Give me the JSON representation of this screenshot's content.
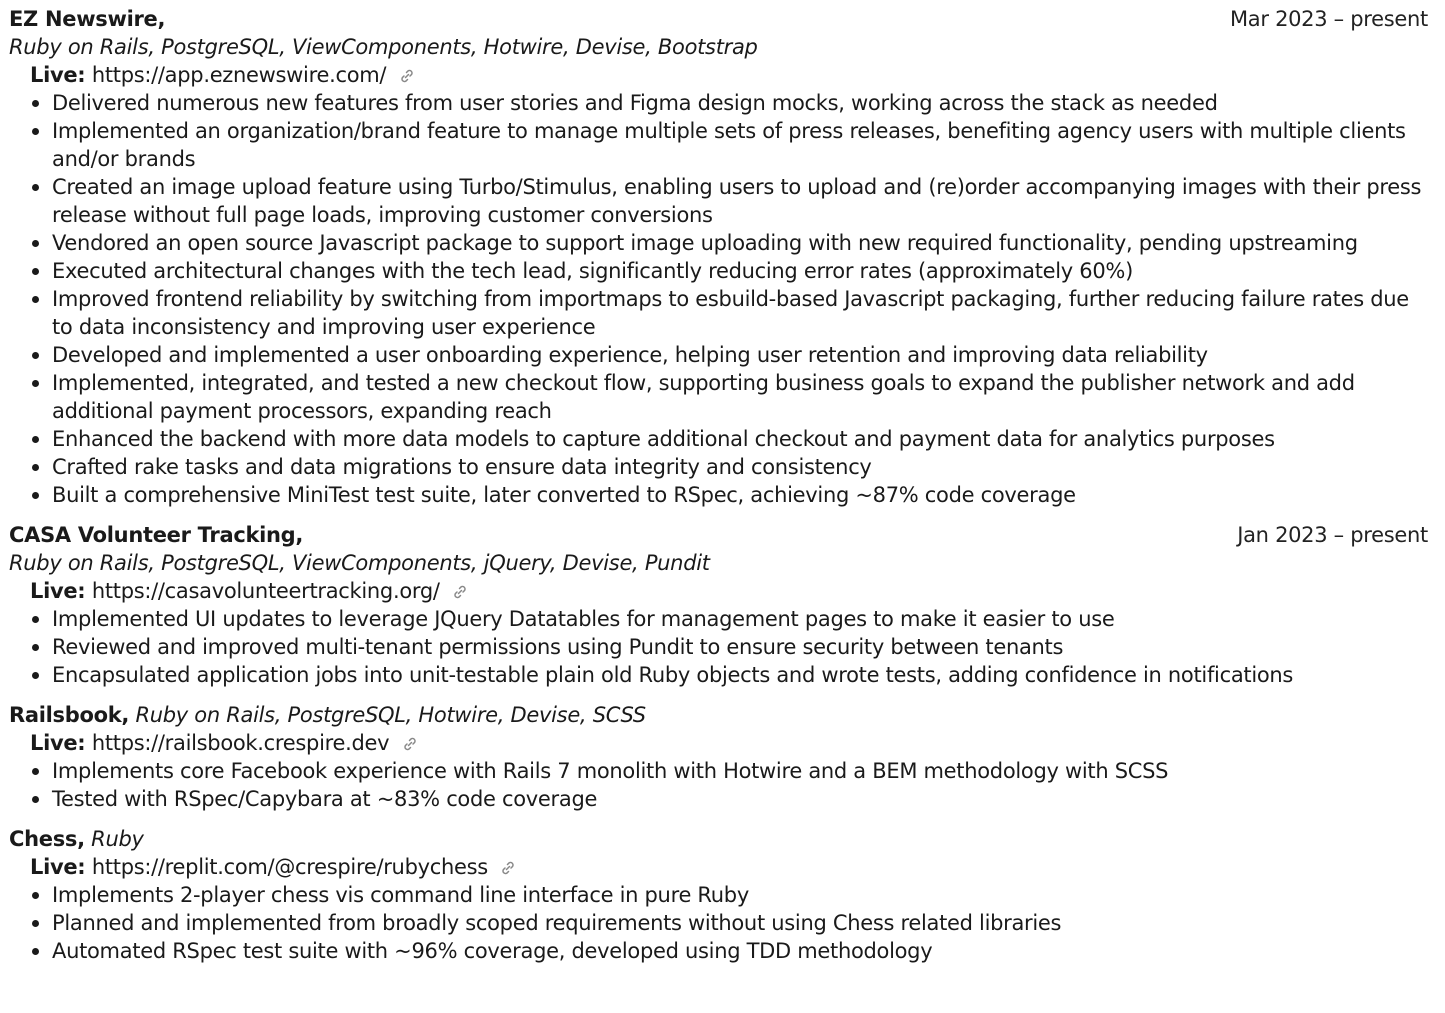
{
  "projects": [
    {
      "title": "EZ Newswire,",
      "tech": "Ruby on Rails, PostgreSQL, ViewComponents, Hotwire, Devise, Bootstrap",
      "date": "Mar 2023 – present",
      "live_label": "Live:",
      "live_url": "https://app.eznewswire.com/",
      "bullets": [
        "Delivered numerous new features from user stories and Figma design mocks, working across the stack as needed",
        "Implemented an organization/brand feature to manage multiple sets of press releases, benefiting agency users with multiple clients and/or brands",
        "Created an image upload feature using Turbo/Stimulus, enabling users to upload and (re)order accompanying images with their press release without full page loads, improving customer conversions",
        "Vendored an open source Javascript package to support image uploading with new required functionality, pending upstreaming",
        "Executed architectural changes with the tech lead, significantly reducing error rates (approximately 60%)",
        "Improved frontend reliability by switching from importmaps to esbuild-based Javascript packaging, further reducing failure rates due to data inconsistency and improving user experience",
        "Developed and implemented a user onboarding experience, helping user retention and improving data reliability",
        "Implemented, integrated, and tested a new checkout flow, supporting business goals to expand the publisher network and add additional payment processors, expanding reach",
        "Enhanced the backend with more data models to capture additional checkout and payment data for analytics purposes",
        "Crafted rake tasks and data migrations to ensure data integrity and consistency",
        "Built a comprehensive MiniTest test suite, later converted to RSpec, achieving ~87% code coverage"
      ]
    },
    {
      "title": "CASA Volunteer Tracking,",
      "tech": "Ruby on Rails, PostgreSQL, ViewComponents, jQuery, Devise, Pundit",
      "date": "Jan 2023 – present",
      "live_label": "Live:",
      "live_url": "https://casavolunteertracking.org/",
      "bullets": [
        "Implemented UI updates to leverage JQuery Datatables for management pages to make it easier to use",
        "Reviewed and improved multi-tenant permissions using Pundit to ensure security between tenants",
        "Encapsulated application jobs into unit-testable plain old Ruby objects and wrote tests, adding confidence in notifications"
      ]
    },
    {
      "title": "Railsbook,",
      "tech": "Ruby on Rails, PostgreSQL, Hotwire, Devise, SCSS",
      "live_label": "Live:",
      "live_url": "https://railsbook.crespire.dev",
      "bullets": [
        "Implements core Facebook experience with Rails 7 monolith with Hotwire and a BEM methodology with SCSS",
        "Tested with RSpec/Capybara at ~83% code coverage"
      ]
    },
    {
      "title": "Chess,",
      "tech": "Ruby",
      "live_label": "Live:",
      "live_url": "https://replit.com/@crespire/rubychess",
      "bullets": [
        "Implements 2-player chess vis command line interface in pure Ruby",
        "Planned and implemented from broadly scoped requirements without using Chess related libraries",
        "Automated RSpec test suite with ~96% coverage, developed using TDD methodology"
      ]
    }
  ]
}
